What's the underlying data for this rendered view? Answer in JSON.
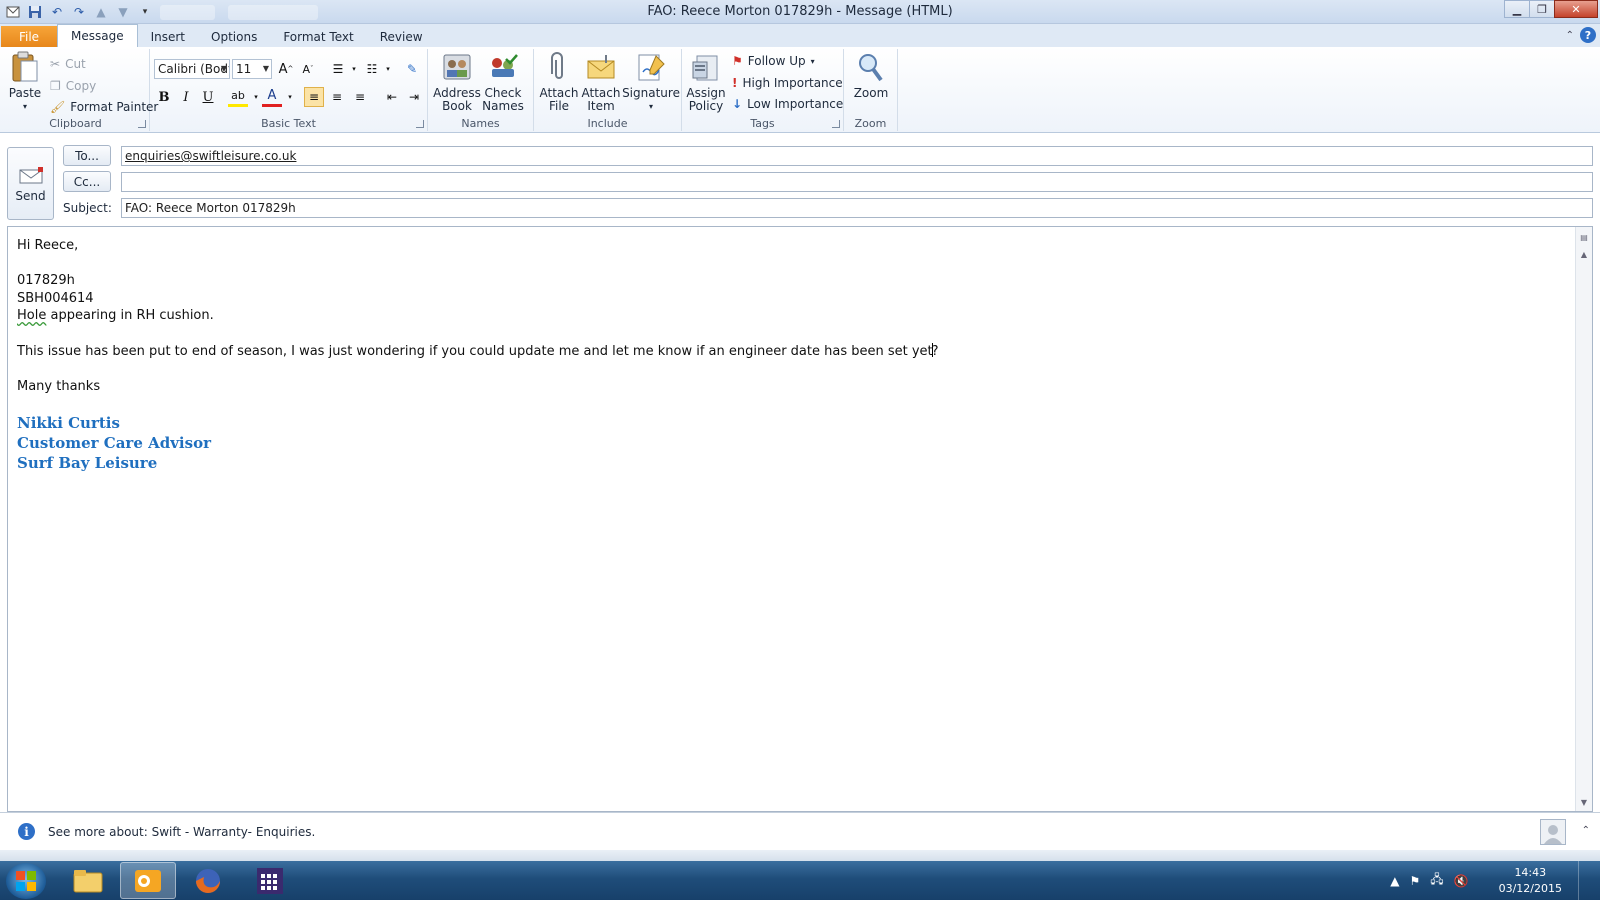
{
  "window": {
    "title": "FAO: Reece Morton 017829h  -  Message (HTML)"
  },
  "ribbon_tabs": [
    {
      "label": "File"
    },
    {
      "label": "Message"
    },
    {
      "label": "Insert"
    },
    {
      "label": "Options"
    },
    {
      "label": "Format Text"
    },
    {
      "label": "Review"
    }
  ],
  "clipboard": {
    "paste": "Paste",
    "cut": "Cut",
    "copy": "Copy",
    "format_painter": "Format Painter",
    "group_label": "Clipboard"
  },
  "basic_text": {
    "font_name": "Calibri (Body)",
    "font_size": "11",
    "group_label": "Basic Text"
  },
  "names": {
    "address_book_line1": "Address",
    "address_book_line2": "Book",
    "check_names_line1": "Check",
    "check_names_line2": "Names",
    "group_label": "Names"
  },
  "include": {
    "attach_file_line1": "Attach",
    "attach_file_line2": "File",
    "attach_item_line1": "Attach",
    "attach_item_line2": "Item",
    "signature": "Signature",
    "group_label": "Include"
  },
  "tags": {
    "assign_policy_line1": "Assign",
    "assign_policy_line2": "Policy",
    "follow_up": "Follow Up",
    "high_importance": "High Importance",
    "low_importance": "Low Importance",
    "group_label": "Tags"
  },
  "zoom": {
    "zoom": "Zoom",
    "group_label": "Zoom"
  },
  "header": {
    "send": "Send",
    "to_button": "To...",
    "cc_button": "Cc...",
    "subject_label": "Subject:",
    "to_value": "enquiries@swiftleisure.co.uk",
    "cc_value": "",
    "subject_value": "FAO: Reece Morton 017829h"
  },
  "body": {
    "greeting": "Hi Reece,",
    "ref1": "017829h",
    "ref2": "SBH004614",
    "issue_word": "Hole",
    "issue_rest": " appearing in RH cushion.",
    "paragraph_before_caret": "This issue has been put to end of season, I was just wondering if you could update me and let me know if an engineer date has been set yet",
    "paragraph_after_caret": "?",
    "closing": "Many thanks",
    "sig_name": "Nikki Curtis",
    "sig_role": "Customer Care Advisor",
    "sig_company": "Surf Bay Leisure"
  },
  "people_pane": {
    "text": "See more about: Swift - Warranty- Enquiries."
  },
  "taskbar": {
    "time": "14:43",
    "date": "03/12/2015"
  },
  "colors": {
    "signature": "#1f6fbf",
    "file_tab": "#e7871b",
    "taskbar": "#1f4d7a"
  }
}
